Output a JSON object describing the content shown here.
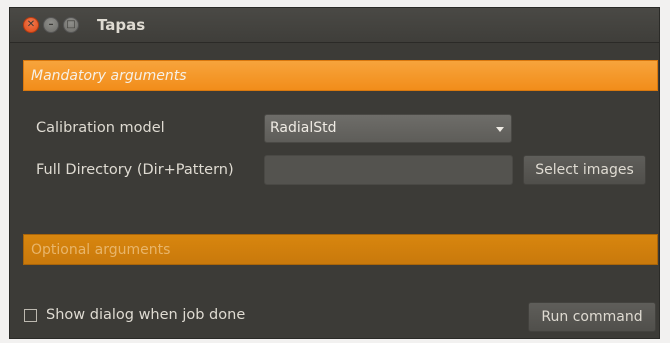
{
  "window": {
    "title": "Tapas",
    "buttons": {
      "close": "close",
      "minimize": "minimize",
      "maximize": "maximize"
    }
  },
  "mandatory": {
    "header": "Mandatory arguments",
    "calibration_model": {
      "label": "Calibration model",
      "selected": "RadialStd"
    },
    "full_directory": {
      "label": "Full Directory (Dir+Pattern)",
      "value": ""
    },
    "select_images_label": "Select images"
  },
  "optional": {
    "header": "Optional arguments"
  },
  "footer": {
    "show_dialog_label": "Show dialog when job done",
    "show_dialog_checked": false,
    "run_label": "Run command"
  },
  "colors": {
    "accent": "#f28d1a",
    "window_bg": "#3c3b37",
    "close_button": "#df4a16"
  }
}
